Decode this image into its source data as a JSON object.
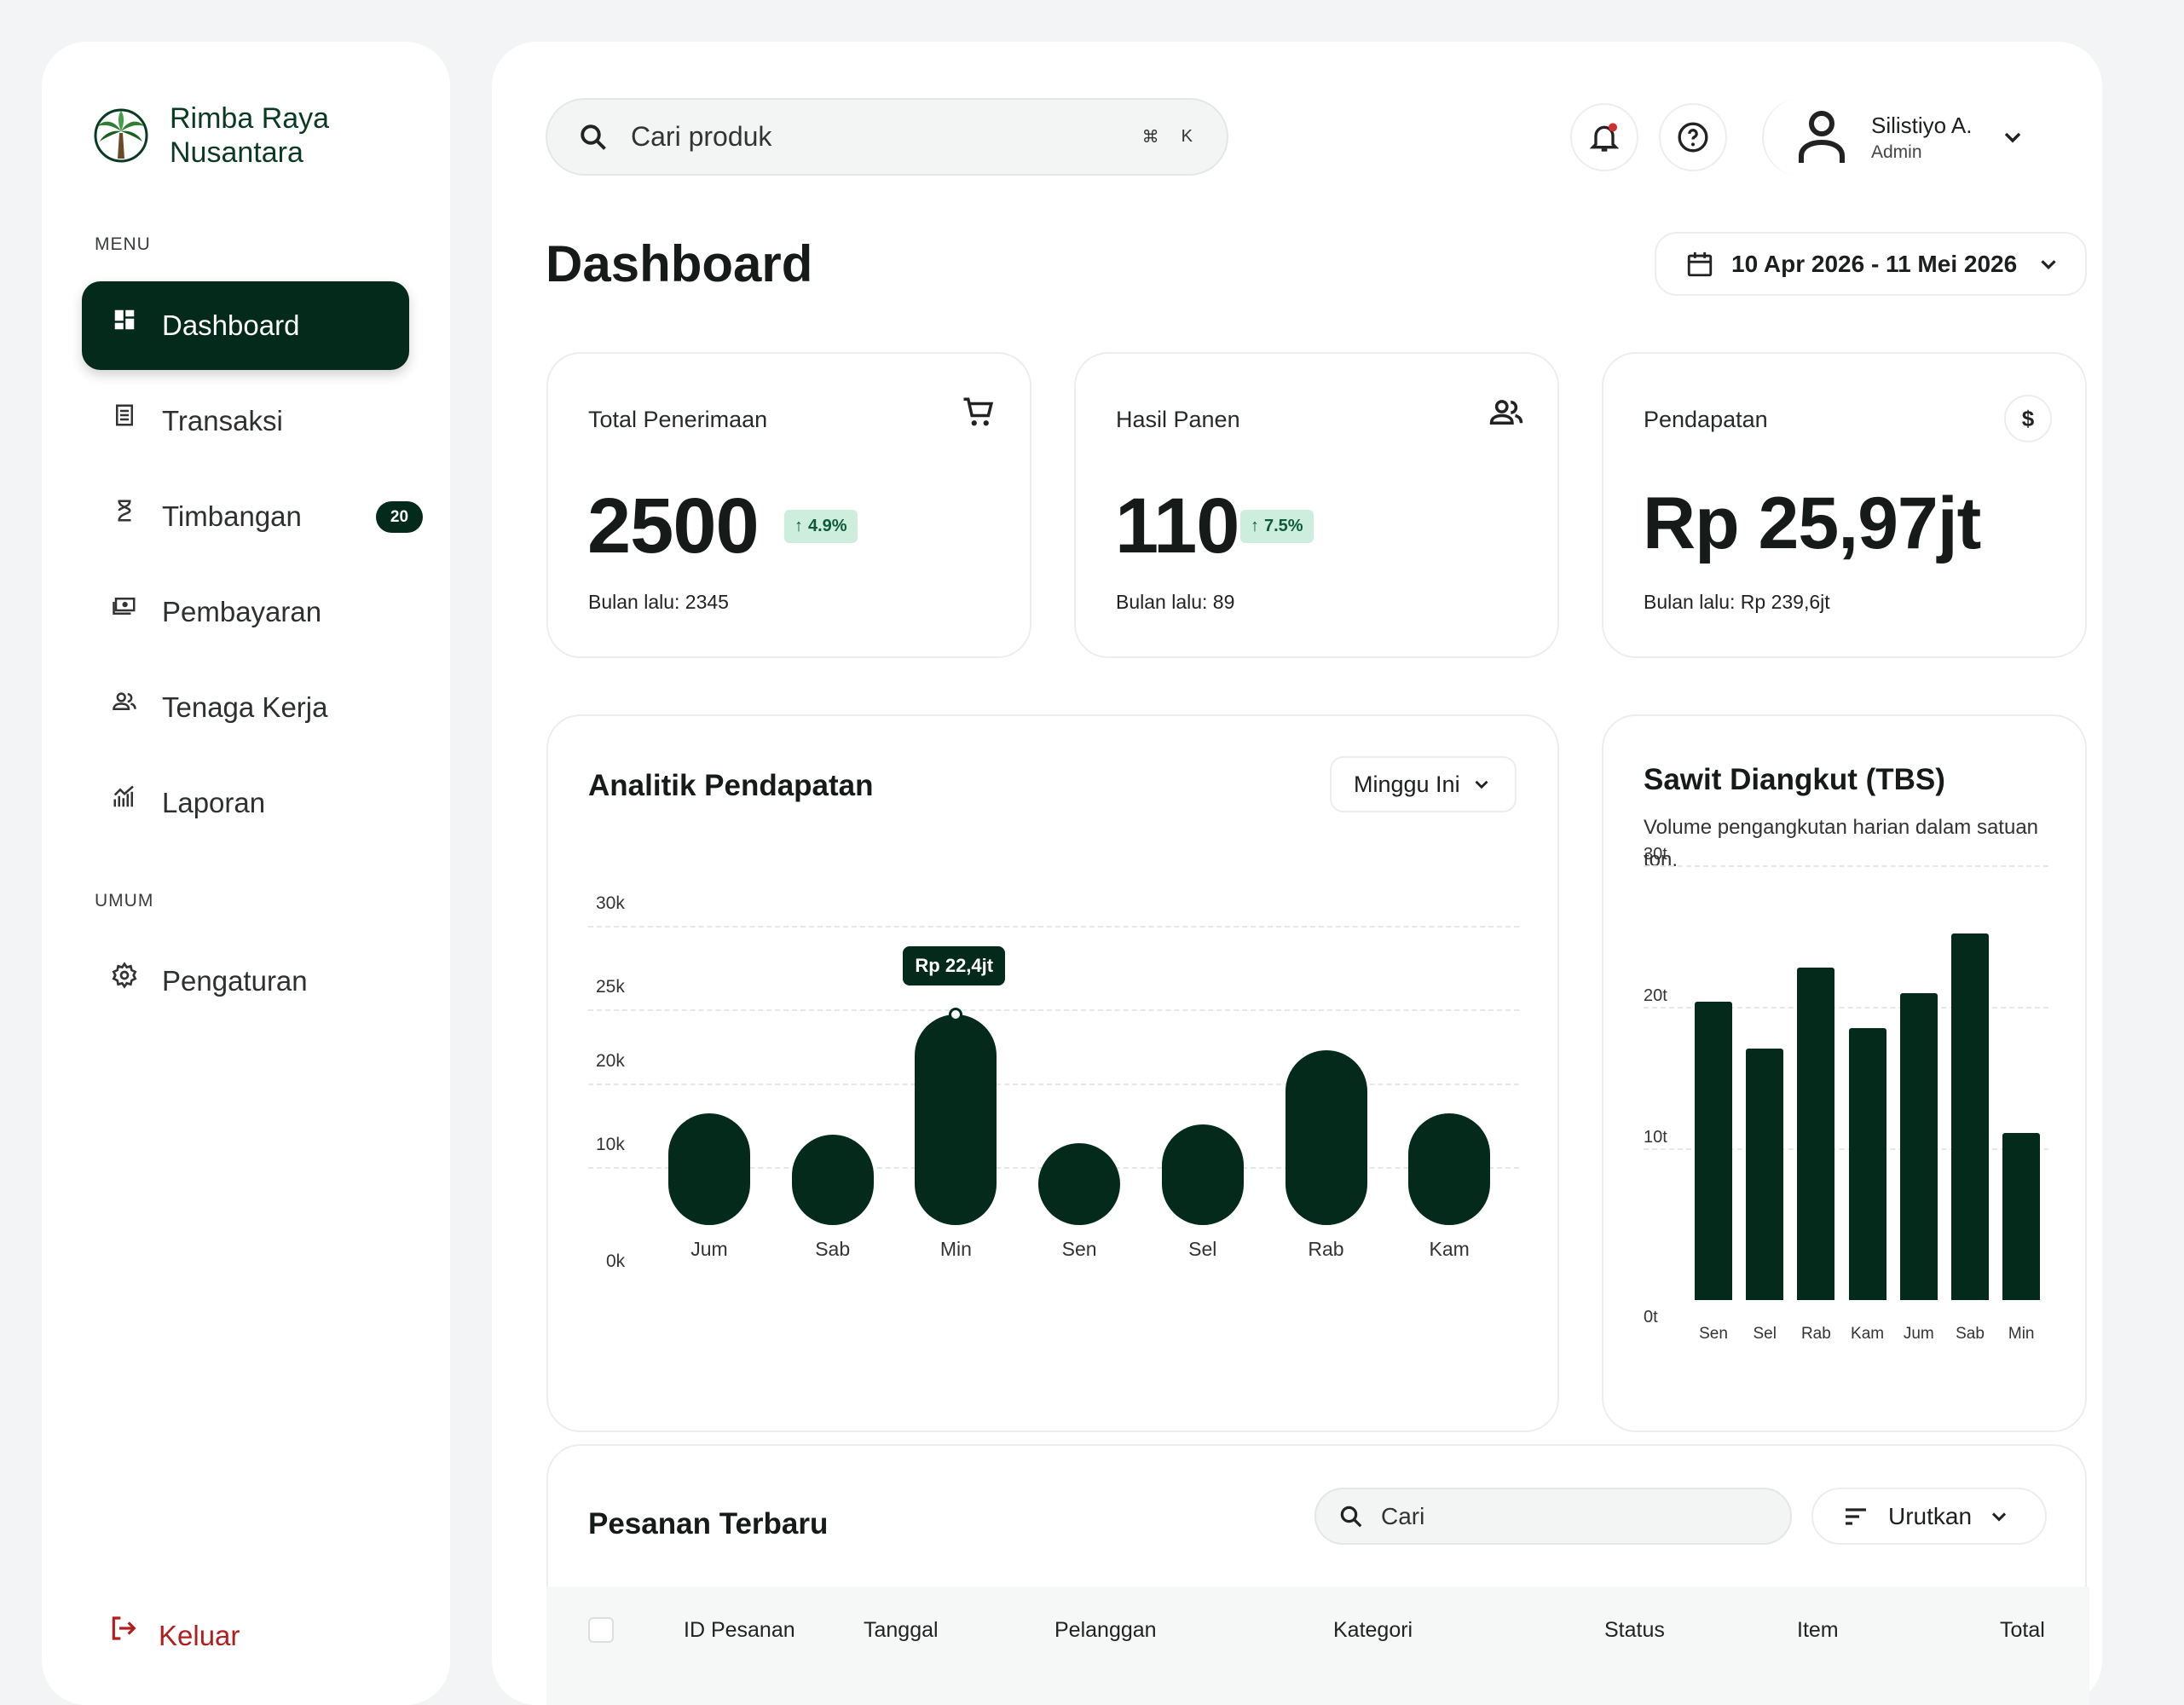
{
  "brand": {
    "line1": "Rimba Raya",
    "line2": "Nusantara"
  },
  "sidebar": {
    "menu_label": "MENU",
    "general_label": "UMUM",
    "items": [
      {
        "label": "Dashboard",
        "icon": "dashboard-icon",
        "active": true
      },
      {
        "label": "Transaksi",
        "icon": "receipt-icon"
      },
      {
        "label": "Timbangan",
        "icon": "hourglass-icon",
        "badge": "20"
      },
      {
        "label": "Pembayaran",
        "icon": "payment-icon"
      },
      {
        "label": "Tenaga Kerja",
        "icon": "people-icon"
      },
      {
        "label": "Laporan",
        "icon": "analytics-icon"
      }
    ],
    "general_items": [
      {
        "label": "Pengaturan",
        "icon": "gear-icon"
      }
    ],
    "logout_label": "Keluar"
  },
  "header": {
    "search_placeholder": "Cari produk",
    "shortcut_cmd": "⌘",
    "shortcut_key": "K",
    "user": {
      "name": "Silistiyo A.",
      "role": "Admin"
    }
  },
  "page": {
    "title": "Dashboard",
    "date_range": "10 Apr 2026 - 11 Mei 2026"
  },
  "stats": [
    {
      "title": "Total Penerimaan",
      "value": "2500",
      "change": "4.9%",
      "sub": "Bulan lalu: 2345",
      "icon": "cart-icon"
    },
    {
      "title": "Hasil Panen",
      "value": "110",
      "change": "7.5%",
      "sub": "Bulan lalu: 89",
      "icon": "people-icon"
    },
    {
      "title": "Pendapatan",
      "value": "Rp 25,97jt",
      "change": "",
      "sub": "Bulan lalu: Rp 239,6jt",
      "icon": "dollar-icon"
    }
  ],
  "revenue": {
    "title": "Analitik Pendapatan",
    "period": "Minggu Ini",
    "tooltip": "Rp 22,4jt",
    "tooltip_index": 2,
    "colors": {
      "bar": "#032a1b"
    }
  },
  "tbs": {
    "title": "Sawit Diangkut (TBS)",
    "description": "Volume pengangkutan harian dalam satuan ton."
  },
  "chart_data": [
    {
      "type": "bar",
      "title": "Analitik Pendapatan",
      "categories": [
        "Jum",
        "Sab",
        "Min",
        "Sen",
        "Sel",
        "Rab",
        "Kam"
      ],
      "values": [
        16.5,
        14.7,
        24.8,
        13.8,
        15.6,
        21.8,
        16.5
      ],
      "y_ticks": [
        "30k",
        "25k",
        "20k",
        "10k",
        "0k"
      ],
      "ylim": [
        10,
        30
      ],
      "grid": true
    },
    {
      "type": "bar",
      "title": "Sawit Diangkut (TBS)",
      "categories": [
        "Sen",
        "Sel",
        "Rab",
        "Kam",
        "Jum",
        "Sab",
        "Min"
      ],
      "values": [
        21.1,
        17.8,
        23.5,
        19.2,
        21.7,
        25.9,
        11.8
      ],
      "y_ticks": [
        "30t",
        "20t",
        "10t",
        "0t"
      ],
      "ylim": [
        0,
        30
      ],
      "grid": true
    }
  ],
  "orders": {
    "title": "Pesanan Terbaru",
    "search_placeholder": "Cari",
    "sort_label": "Urutkan",
    "columns": [
      "ID Pesanan",
      "Tanggal",
      "Pelanggan",
      "Kategori",
      "Status",
      "Item",
      "Total"
    ]
  }
}
